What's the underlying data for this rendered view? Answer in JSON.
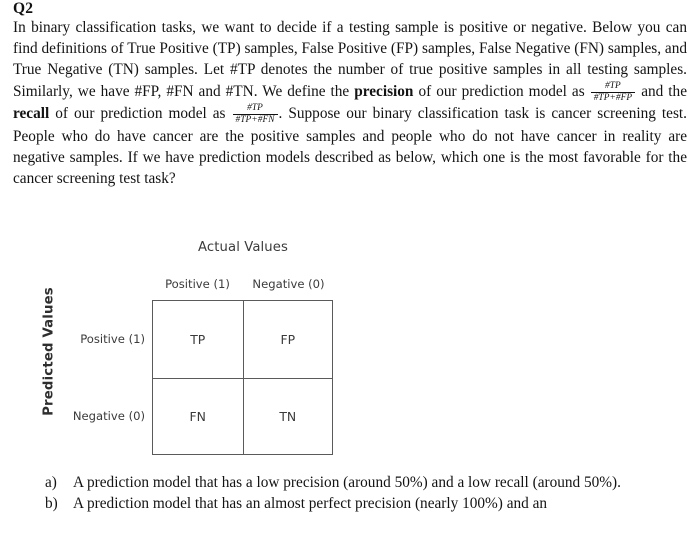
{
  "document": {
    "background_color": "#ffffff",
    "text_color": "#131313",
    "diagram_color": "#3b3b3b",
    "border_color": "#5a5a5a"
  },
  "question": {
    "heading": "Q2",
    "body_part_1": "In binary classification tasks, we want to decide if a testing sample is positive or negative. Below you can find definitions of True Positive (TP) samples, False Positive (FP) samples, False Negative (FN) samples, and True Negative (TN) samples. Let #TP denotes the number of true positive samples in all testing samples. Similarly, we have #FP, #FN and #TN. We define the ",
    "bold_precision": "precision",
    "body_part_2": " of our prediction model as ",
    "precision_formula": {
      "numerator": "#TP",
      "denominator": "#TP+#FP"
    },
    "body_part_3": " and the ",
    "bold_recall": "recall",
    "body_part_4": " of our prediction model as ",
    "recall_formula": {
      "numerator": "#TP",
      "denominator": "#TP+#FN"
    },
    "body_part_5": ". Suppose our binary classification task is cancer screening test. People who do have cancer are the positive samples and people who do not have cancer in reality are negative samples. If we have prediction models described as below, which one is the most favorable for the cancer screening test task?"
  },
  "matrix": {
    "column_axis_title": "Actual Values",
    "row_axis_title": "Predicted Values",
    "column_headers": [
      "Positive (1)",
      "Negative (0)"
    ],
    "row_headers": [
      "Positive (1)",
      "Negative (0)"
    ],
    "cells": [
      [
        "TP",
        "FP"
      ],
      [
        "FN",
        "TN"
      ]
    ]
  },
  "options": [
    {
      "marker": "a)",
      "text": "A prediction model that has a low precision (around 50%) and a low recall (around 50%)."
    },
    {
      "marker": "b)",
      "text": "A prediction model that has an almost perfect precision (nearly 100%) and an"
    }
  ]
}
